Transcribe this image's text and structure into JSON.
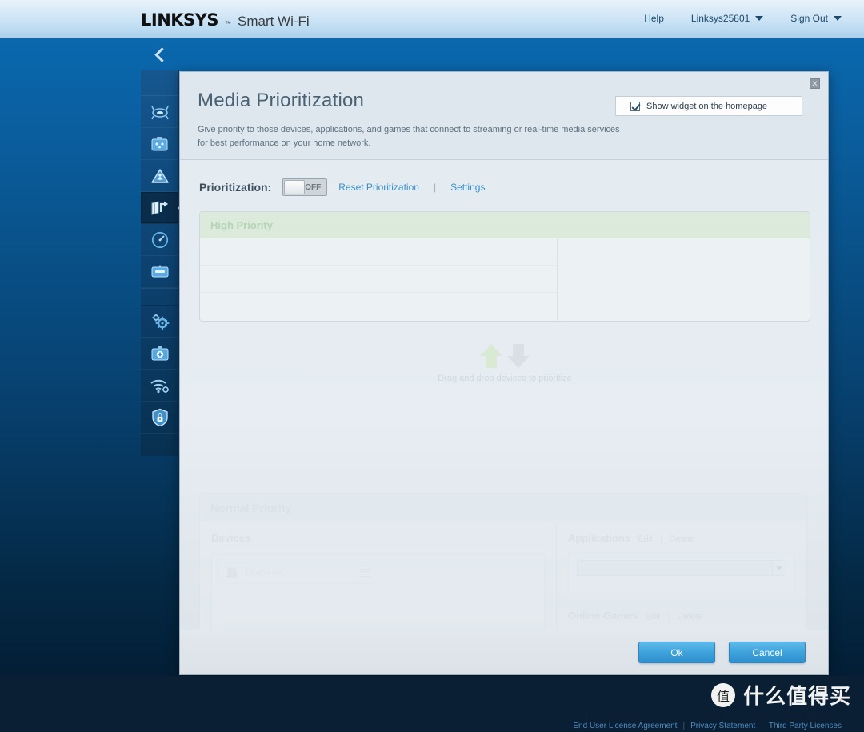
{
  "topbar": {
    "brand_name": "LINKSYS",
    "brand_tm": "™",
    "brand_product": "Smart Wi-Fi",
    "nav": [
      {
        "label": "Help",
        "has_caret": false
      },
      {
        "label": "Linksys25801",
        "has_caret": true
      },
      {
        "label": "Sign Out",
        "has_caret": true
      }
    ]
  },
  "sidebar": {
    "collapse_icon": "chevron-left-icon",
    "items": [
      {
        "name": "router-icon",
        "label": "Router Settings"
      },
      {
        "name": "guest-access-icon",
        "label": "Guest Access"
      },
      {
        "name": "parental-controls-icon",
        "label": "Parental Controls"
      },
      {
        "name": "media-prioritization-icon",
        "label": "Media Prioritization",
        "active": true
      },
      {
        "name": "speed-test-icon",
        "label": "Speed Test"
      },
      {
        "name": "external-storage-icon",
        "label": "External Storage"
      },
      {
        "name": "connectivity-gears-icon",
        "label": "Connectivity"
      },
      {
        "name": "troubleshooting-icon",
        "label": "Troubleshooting"
      },
      {
        "name": "wireless-icon",
        "label": "Wireless"
      },
      {
        "name": "security-shield-icon",
        "label": "Security"
      }
    ]
  },
  "modal": {
    "title": "Media Prioritization",
    "description": "Give priority to those devices, applications, and games that connect to streaming or real-time media services for best performance on your home network.",
    "close_label": "✕",
    "show_widget": {
      "label": "Show widget on the homepage",
      "checked": true
    },
    "prioritization": {
      "label": "Prioritization:",
      "toggle_state": "OFF",
      "reset_link": "Reset Prioritization",
      "separator": "|",
      "settings_link": "Settings"
    },
    "high_priority": {
      "title": "High Priority",
      "slot_count": 3
    },
    "dragzone": {
      "text": "Drag and drop devices to prioritize",
      "up_arrow_color": "#d6e6d3",
      "down_arrow_color": "#d7dee3"
    },
    "normal_priority": {
      "title": "Normal Priority",
      "devices": {
        "title": "Devices",
        "items": [
          {
            "name": "TIGER-PC",
            "icon": "computer-icon"
          }
        ]
      },
      "applications": {
        "title": "Applications",
        "edit_label": "Edit",
        "separator": "|",
        "delete_label": "Delete",
        "select_value": ""
      },
      "online_games": {
        "title": "Online Games",
        "edit_label": "Edit",
        "separator": "|",
        "delete_label": "Delete",
        "select_value": ""
      }
    },
    "footer": {
      "ok_label": "Ok",
      "cancel_label": "Cancel"
    }
  },
  "page_footer": {
    "links": [
      "End User License Agreement",
      "Privacy Statement",
      "Third Party Licenses"
    ],
    "separator": "|"
  },
  "watermark": {
    "logo_char": "值",
    "text": "什么值得买"
  },
  "colors": {
    "accent_blue": "#3ea2db",
    "sidebar_blue": "#0f4a7d",
    "high_priority_green": "#dbeadb",
    "modal_bg": "#e4ebf1"
  }
}
